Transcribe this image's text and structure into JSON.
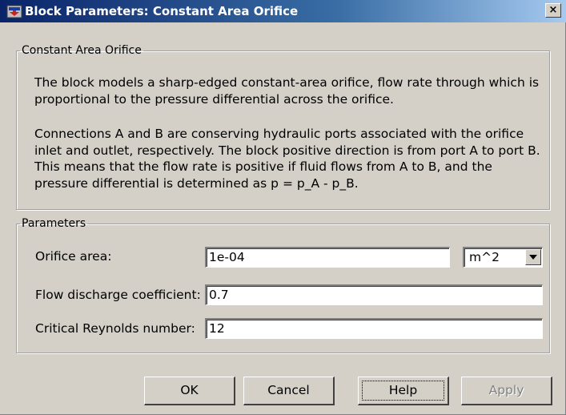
{
  "window": {
    "title": "Block Parameters: Constant Area Orifice",
    "close_glyph": "×",
    "title_icon": "simulink-block-icon"
  },
  "description_group": {
    "legend": "Constant Area Orifice",
    "paragraph1": "The block models a sharp-edged constant-area orifice, flow rate through which is proportional to the pressure differential across the orifice.",
    "paragraph2": "Connections A and B are conserving hydraulic ports associated with the orifice inlet and outlet, respectively. The block positive direction is from port A to port B. This means that the flow rate is positive if fluid flows from A to B, and the pressure differential is determined as p = p_A - p_B."
  },
  "parameters_group": {
    "legend": "Parameters",
    "orifice_area": {
      "label": "Orifice area:",
      "value": "1e-04",
      "unit": "m^2"
    },
    "discharge_coefficient": {
      "label": "Flow discharge coefficient:",
      "value": "0.7"
    },
    "critical_reynolds": {
      "label": "Critical Reynolds number:",
      "value": "12"
    }
  },
  "buttons": {
    "ok": "OK",
    "cancel": "Cancel",
    "help": "Help",
    "apply": "Apply"
  }
}
